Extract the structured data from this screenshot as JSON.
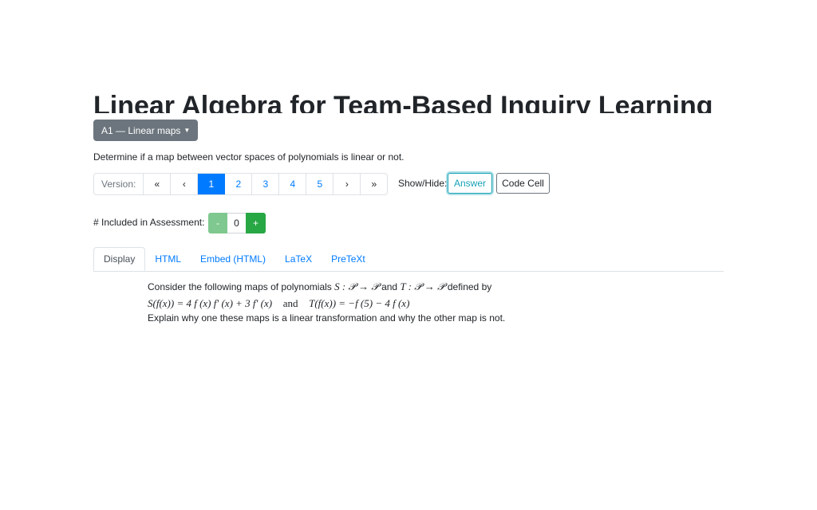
{
  "page": {
    "title": "Linear Algebra for Team-Based Inquiry Learning",
    "dropdown_label": "A1 — Linear maps",
    "description": "Determine if a map between vector spaces of polynomials is linear or not."
  },
  "version": {
    "label": "Version:",
    "first": "«",
    "prev": "‹",
    "pages": [
      "1",
      "2",
      "3",
      "4",
      "5"
    ],
    "active_page": "1",
    "next": "›",
    "last": "»"
  },
  "showhide": {
    "label": "Show/Hide:",
    "answer_label": "Answer",
    "code_cell_label": "Code Cell"
  },
  "assessment": {
    "label": "# Included in Assessment:",
    "minus": "-",
    "value": "0",
    "plus": "+"
  },
  "tabs": [
    "Display",
    "HTML",
    "Embed (HTML)",
    "LaTeX",
    "PreTeXt"
  ],
  "active_tab": "Display",
  "content": {
    "intro_text": "Consider the following maps of polynomials",
    "S_map": "S : 𝒫 → 𝒫",
    "and_word": "and",
    "T_map": "T : 𝒫 → 𝒫",
    "defined_by": "defined by",
    "S_def": "S(f(x)) = 4 f (x) f′ (x) + 3 f′ (x)",
    "display_and": "and",
    "T_def": "T(f(x)) = −f (5) − 4 f (x)",
    "outro_text": "Explain why one these maps is a linear transformation and why the other map is not."
  },
  "colors": {
    "primary": "#007bff",
    "secondary": "#6c757d",
    "info": "#17a2b8",
    "success": "#28a745"
  }
}
